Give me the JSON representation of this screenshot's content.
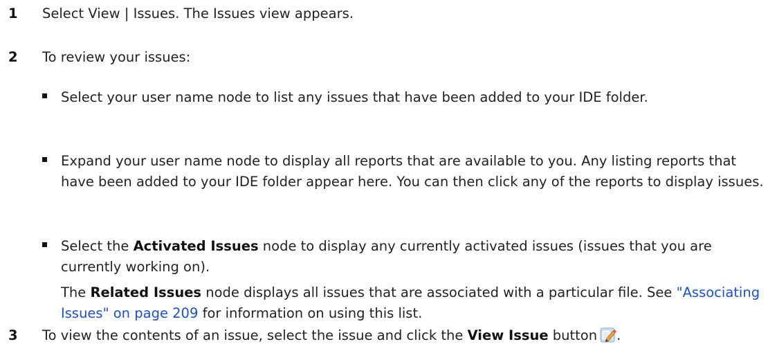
{
  "steps": [
    {
      "number": "1",
      "text": "Select View | Issues. The Issues view appears."
    },
    {
      "number": "2",
      "text": "To review your issues:"
    },
    {
      "number": "3",
      "text_before": "To view the contents of an issue, select the issue and click the ",
      "bold": "View Issue",
      "text_after": " button",
      "end_period": ".",
      "icon": "edit-pencil-icon"
    }
  ],
  "bullets": [
    {
      "text": "Select your user name node to list any issues that have been added to your IDE folder."
    },
    {
      "text": "Expand your user name node to display all reports that are available to you. Any listing reports that have been added to your IDE folder appear here. You can then click any of the reports to display issues."
    },
    {
      "before": "Select the ",
      "bold": "Activated Issues",
      "after": " node to display any currently activated issues (issues that you are currently working on)."
    }
  ],
  "note": {
    "before": "The ",
    "bold": "Related Issues",
    "middle": " node displays all issues that are associated with a particular file. See ",
    "link": "\"Associating Issues\" on page 209",
    "after": " for information on using this list."
  },
  "colors": {
    "link": "#1a4fd6",
    "text": "#222222"
  }
}
